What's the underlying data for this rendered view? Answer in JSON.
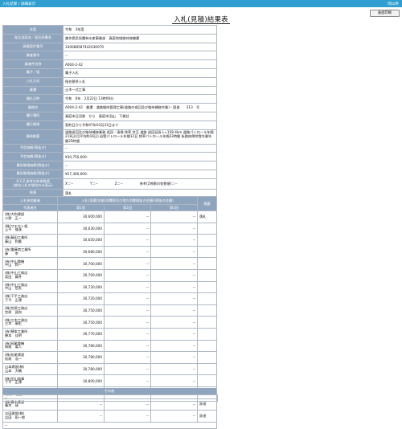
{
  "header": {
    "breadcrumb": "入札結果 / 詳細表示",
    "org": "岡山県"
  },
  "toolbar": {
    "print_label": "画面印刷"
  },
  "page": {
    "title": "入札(見積)結果表"
  },
  "info": [
    {
      "label": "年度",
      "value": "令和　3年度"
    },
    {
      "label": "発注部局名／発注所属名",
      "value": "美作県民局農林水産事業部　真庭地域維持修繕課"
    },
    {
      "label": "調達案件番号",
      "value": "330088587442030079"
    },
    {
      "label": "業者番号",
      "value": "--"
    },
    {
      "label": "業者件名称",
      "value": "A004-2-42"
    },
    {
      "label": "電子／紙",
      "value": "電子入札"
    },
    {
      "label": "入札方式",
      "value": "指名競争入札"
    },
    {
      "label": "業種",
      "value": "土木一式工事"
    },
    {
      "label": "開札日時",
      "value": "令和　6年　2月22日 13時00分"
    },
    {
      "label": "業務名",
      "value": "A004-2-42　美濃　道路維持管理工事(道路の巡回及び維持補修作業)・国道　　313　号"
    },
    {
      "label": "履行場所",
      "value": "真庭市日羽鉄　から　真庭市羽山　下美甘"
    },
    {
      "label": "履行期限",
      "value": "契約日から令和07年03月31日まで"
    },
    {
      "label": "業務概要",
      "value": "道路巡回及び維持補修業務 巡回 - 清掃 除草 交互 道路 巡回延長 L=158.4km 道路パトロール年間218日(月平均約16日) 岩壁パトロール年間12日 除草パトロール年間33時間 街路肉厚除雪作業年間25時間",
      "wrap": true
    },
    {
      "label": "予定価格(税抜き)",
      "value": "--"
    },
    {
      "label": "予定価格(税抜き)",
      "value": "¥30,750,000-"
    },
    {
      "label": "最低制限価格(税抜き)",
      "value": "--"
    },
    {
      "label": "最低制限価格(税抜き)",
      "value": "¥27,360,000-"
    },
    {
      "label": "X,Y,Z,参考の各係数値\n(総合入札の場合のみ表示)",
      "value": "X＝--　　　　　Y＝--　　　　　Z＝--　　　　　参考(Z係数の各数値)＝--",
      "wrap": true
    },
    {
      "label": "結果",
      "value": "落札"
    }
  ],
  "participants": {
    "headers": {
      "bidder": "入札参加業者",
      "amount_group": "入札(見積)金額(消費税及び地方消費税抜き金額)(税抜き金額)",
      "rep": "代表者名",
      "r1": "第1回",
      "r2": "第2回",
      "r3": "第3回",
      "remark": "摘要"
    },
    "rows": [
      {
        "name": "(株)大和建設\n小野　正一",
        "r1": "30,600,000",
        "r2": "--",
        "r3": "--",
        "remark": "落札"
      },
      {
        "name": "(株)ワエモト組\n上平　隆達",
        "r1": "30,630,000",
        "r2": "--",
        "r3": "--",
        "remark": ""
      },
      {
        "name": "(株)藤田工業所\n藤山　和美",
        "r1": "30,650,000",
        "r2": "--",
        "r3": "--",
        "remark": ""
      },
      {
        "name": "(有)重藤商工業所\n藤　　幸",
        "r1": "30,680,000",
        "r2": "--",
        "r3": "--",
        "remark": ""
      },
      {
        "name": "(有)中山重機\n中山　和一",
        "r1": "30,700,000",
        "r2": "--",
        "r3": "--",
        "remark": ""
      },
      {
        "name": "(株)中山工務店\n実田　藤井",
        "r1": "30,700,000",
        "r2": "--",
        "r3": "--",
        "remark": ""
      },
      {
        "name": "(株)中山工務店\n中山　信夫",
        "r1": "30,720,000",
        "r2": "--",
        "r3": "--",
        "remark": ""
      },
      {
        "name": "(株)下平工務店\n下平　正博",
        "r1": "30,720,000",
        "r2": "--",
        "r3": "--",
        "remark": ""
      },
      {
        "name": "(株)笠原工務店\n笠原　昌和",
        "r1": "30,750,000",
        "r2": "--",
        "r3": "--",
        "remark": ""
      },
      {
        "name": "(株)三木工務店\n三木　康史",
        "r1": "30,750,000",
        "r2": "--",
        "r3": "--",
        "remark": ""
      },
      {
        "name": "(有)穂本工業所\n穂本　佳明",
        "r1": "30,770,000",
        "r2": "--",
        "r3": "--",
        "remark": ""
      },
      {
        "name": "(有)岡尾重機\n岡尾　竜人",
        "r1": "30,780,000",
        "r2": "--",
        "r3": "--",
        "remark": ""
      },
      {
        "name": "(株)松尾建設\n松尾　浩一",
        "r1": "30,780,000",
        "r2": "--",
        "r3": "--",
        "remark": ""
      },
      {
        "name": "山本建設(株)\n山本　大輔",
        "r1": "30,780,000",
        "r2": "--",
        "r3": "--",
        "remark": ""
      },
      {
        "name": "(株)田山商事\n下平　正博",
        "r1": "30,800,000",
        "r2": "--",
        "r3": "--",
        "remark": ""
      },
      {
        "name": "(株)角尾組\n角尾　敏史",
        "r1": "30,800,000",
        "r2": "--",
        "r3": "--",
        "remark": ""
      },
      {
        "name": "(株)春木建設\n春木　靖",
        "r1": "--",
        "r2": "--",
        "r3": "--",
        "remark": "辞退"
      },
      {
        "name": "吉田建設(株)\n吉田　昭一郎",
        "r1": "--",
        "r2": "--",
        "r3": "--",
        "remark": "辞退"
      }
    ],
    "footer": "--"
  },
  "other": {
    "label": "その他",
    "value": "--"
  }
}
